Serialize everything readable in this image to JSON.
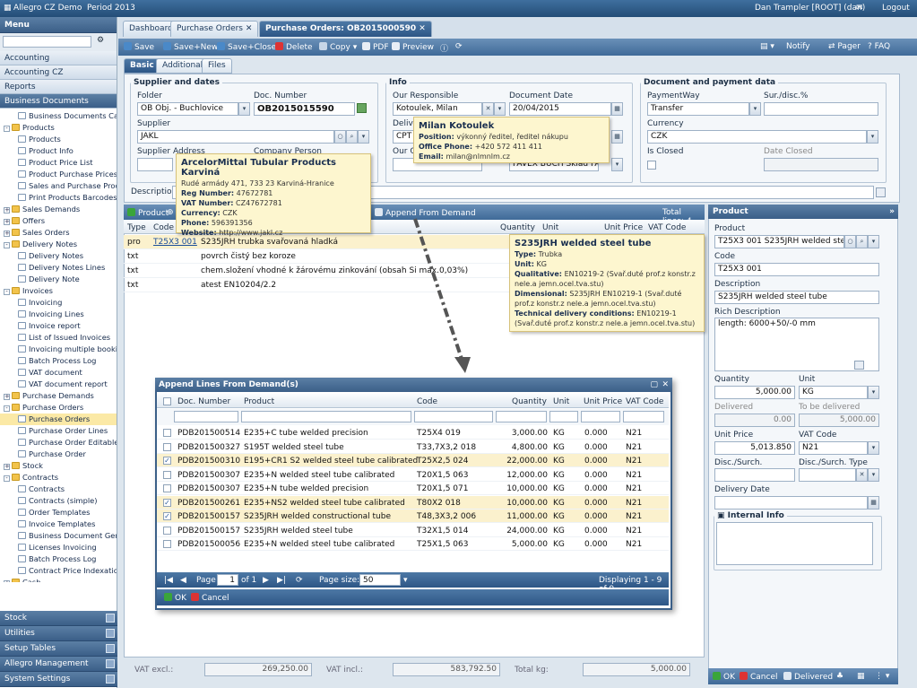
{
  "topbar": {
    "company": "Allegro CZ Demo",
    "period": "Period 2013",
    "user": "Dan Trampler [ROOT] (dan)",
    "logout": "Logout"
  },
  "menu": {
    "title": "Menu",
    "sections": [
      "Accounting",
      "Accounting CZ",
      "Reports",
      "Business Documents"
    ],
    "tree": [
      {
        "label": "Business Documents Calend",
        "type": "doc",
        "indent": 1
      },
      {
        "label": "Products",
        "type": "fold",
        "indent": 0,
        "toggle": "-"
      },
      {
        "label": "Products",
        "type": "doc",
        "indent": 1
      },
      {
        "label": "Product Info",
        "type": "doc",
        "indent": 1
      },
      {
        "label": "Product Price List",
        "type": "doc",
        "indent": 1
      },
      {
        "label": "Product Purchase Prices",
        "type": "doc",
        "indent": 1
      },
      {
        "label": "Sales and Purchase Prod",
        "type": "doc",
        "indent": 1
      },
      {
        "label": "Print Products Barcodes",
        "type": "doc",
        "indent": 1
      },
      {
        "label": "Sales Demands",
        "type": "fold",
        "indent": 0,
        "toggle": "+"
      },
      {
        "label": "Offers",
        "type": "fold",
        "indent": 0,
        "toggle": "+"
      },
      {
        "label": "Sales Orders",
        "type": "fold",
        "indent": 0,
        "toggle": "+"
      },
      {
        "label": "Delivery Notes",
        "type": "fold",
        "indent": 0,
        "toggle": "-"
      },
      {
        "label": "Delivery Notes",
        "type": "doc",
        "indent": 1
      },
      {
        "label": "Delivery Notes Lines",
        "type": "doc",
        "indent": 1
      },
      {
        "label": "Delivery Note",
        "type": "doc",
        "indent": 1
      },
      {
        "label": "Invoices",
        "type": "fold",
        "indent": 0,
        "toggle": "-"
      },
      {
        "label": "Invoicing",
        "type": "doc",
        "indent": 1
      },
      {
        "label": "Invoicing Lines",
        "type": "doc",
        "indent": 1
      },
      {
        "label": "Invoice report",
        "type": "doc",
        "indent": 1
      },
      {
        "label": "List of Issued Invoices",
        "type": "doc",
        "indent": 1
      },
      {
        "label": "Invoicing multiple booking",
        "type": "doc",
        "indent": 1
      },
      {
        "label": "Batch Process Log",
        "type": "doc",
        "indent": 1
      },
      {
        "label": "VAT document",
        "type": "doc",
        "indent": 1
      },
      {
        "label": "VAT document report",
        "type": "doc",
        "indent": 1
      },
      {
        "label": "Purchase Demands",
        "type": "fold",
        "indent": 0,
        "toggle": "+"
      },
      {
        "label": "Purchase Orders",
        "type": "fold",
        "indent": 0,
        "toggle": "-"
      },
      {
        "label": "Purchase Orders",
        "type": "doc",
        "indent": 1,
        "selected": true
      },
      {
        "label": "Purchase Order Lines",
        "type": "doc",
        "indent": 1
      },
      {
        "label": "Purchase Order Editable L",
        "type": "doc",
        "indent": 1
      },
      {
        "label": "Purchase Order",
        "type": "doc",
        "indent": 1
      },
      {
        "label": "Stock",
        "type": "fold",
        "indent": 0,
        "toggle": "+"
      },
      {
        "label": "Contracts",
        "type": "fold",
        "indent": 0,
        "toggle": "-"
      },
      {
        "label": "Contracts",
        "type": "doc",
        "indent": 1
      },
      {
        "label": "Contracts (simple)",
        "type": "doc",
        "indent": 1
      },
      {
        "label": "Order Templates",
        "type": "doc",
        "indent": 1
      },
      {
        "label": "Invoice Templates",
        "type": "doc",
        "indent": 1
      },
      {
        "label": "Business Document Gene",
        "type": "doc",
        "indent": 1
      },
      {
        "label": "Licenses Invoicing",
        "type": "doc",
        "indent": 1
      },
      {
        "label": "Batch Process Log",
        "type": "doc",
        "indent": 1
      },
      {
        "label": "Contract Price Indexation",
        "type": "doc",
        "indent": 1
      },
      {
        "label": "Cash",
        "type": "fold",
        "indent": 0,
        "toggle": "+"
      }
    ],
    "bottom": [
      "Stock",
      "Utilities",
      "Setup Tables",
      "Allegro Management",
      "System Settings"
    ]
  },
  "tabs": [
    "Dashboard",
    "Purchase Orders",
    "Purchase Orders: OB2015000590"
  ],
  "toolbar": {
    "save": "Save",
    "save_new": "Save+New",
    "save_close": "Save+Close",
    "delete": "Delete",
    "copy": "Copy",
    "pdf": "PDF",
    "preview": "Preview",
    "notify": "Notify",
    "pager": "Pager",
    "faq": "FAQ"
  },
  "subtabs": [
    "Basic",
    "Additional",
    "Files"
  ],
  "supplier": {
    "legend": "Supplier and dates",
    "folder_label": "Folder",
    "folder": "OB Obj. - Buchlovice",
    "docnum_label": "Doc. Number",
    "docnum": "OB2015015590",
    "supplier_label": "Supplier",
    "supplier": "JAKL",
    "address_label": "Supplier Address",
    "company_label": "Company Person"
  },
  "info": {
    "legend": "Info",
    "resp_label": "Our Responsible",
    "resp": "Kotoulek, Milan",
    "date_label": "Document Date",
    "date": "20/04/2015",
    "deliv_label": "Delive",
    "deliv": "CPT",
    "ourc_label": "Our C",
    "stock": "FAVEX BUCH Sklad FAVE"
  },
  "payment": {
    "legend": "Document and payment data",
    "pw_label": "PaymentWay",
    "pw": "Transfer",
    "sur_label": "Sur./disc.%",
    "cur_label": "Currency",
    "cur": "CZK",
    "closed_label": "Is Closed",
    "dclosed_label": "Date Closed"
  },
  "description_label": "Description:",
  "tip_supplier": {
    "title": "ArcelorMittal Tubular Products Karviná",
    "address": "Rudé armády 471, 733 23 Karviná-Hranice",
    "rows": [
      [
        "Reg Number:",
        "47672781"
      ],
      [
        "VAT Number:",
        "CZ47672781"
      ],
      [
        "Currency:",
        "CZK"
      ],
      [
        "Phone:",
        "596391356"
      ],
      [
        "Website:",
        "http://www.jakl.cz"
      ]
    ]
  },
  "tip_person": {
    "title": "Milan Kotoulek",
    "rows": [
      [
        "Position:",
        "výkonný ředitel, ředitel nákupu"
      ],
      [
        "Office Phone:",
        "+420 572 411 411"
      ],
      [
        "Email:",
        "milan@nlmnlm.cz"
      ]
    ]
  },
  "tip_product": {
    "title": "S235JRH welded steel tube",
    "rows": [
      [
        "Type:",
        "Trubka"
      ],
      [
        "Unit:",
        "KG"
      ],
      [
        "Qualitative:",
        "EN10219-2 (Svař.duté prof.z konstr.z nele.a jemn.ocel.tva.stu)"
      ],
      [
        "Dimensional:",
        "S235JRH EN10219-1 (Svař.duté prof.z konstr.z nele.a jemn.ocel.tva.stu)"
      ],
      [
        "Technical delivery conditions:",
        "EN10219-1 (Svař.duté prof.z konstr.z nele.a jemn.ocel.tva.stu)"
      ]
    ]
  },
  "grid": {
    "add_product": "Product",
    "append": "Append From Demand",
    "total": "Total lines: 4",
    "cols": [
      "Type",
      "Code",
      "Quantity",
      "Unit",
      "Unit Price",
      "VAT Code"
    ],
    "rows": [
      {
        "type": "pro",
        "code": "T25X3 001",
        "desc": "S235JRH trubka svařovaná hladká"
      },
      {
        "type": "txt",
        "code": "",
        "desc": "povrch čistý bez koroze"
      },
      {
        "type": "txt",
        "code": "",
        "desc": "chem.složení vhodné k žárovému zinkování (obsah Si max.0,03%)"
      },
      {
        "type": "txt",
        "code": "",
        "desc": "atest EN10204/2.2"
      }
    ]
  },
  "footer": {
    "vat_excl_label": "VAT excl.:",
    "vat_excl": "269,250.00",
    "vat_incl_label": "VAT incl.:",
    "vat_incl": "583,792.50",
    "kg_label": "Total kg:",
    "kg": "5,000.00"
  },
  "product": {
    "title": "Product",
    "product_label": "Product",
    "product": "T25X3 001 S235JRH welded steel t",
    "code_label": "Code",
    "code": "T25X3 001",
    "desc_label": "Description",
    "desc": "S235JRH welded steel tube",
    "rich_label": "Rich Description",
    "rich": "length: 6000+50/-0 mm",
    "qty_label": "Quantity",
    "qty": "5,000.00",
    "unit_label": "Unit",
    "unit": "KG",
    "delivered_label": "Delivered",
    "delivered": "0.00",
    "tobe_label": "To be delivered",
    "tobe": "5,000.00",
    "price_label": "Unit Price",
    "price": "5,013.850",
    "vat_label": "VAT Code",
    "vat": "N21",
    "disc_label": "Disc./Surch.",
    "disctype_label": "Disc./Surch. Type",
    "deldate_label": "Delivery Date",
    "internal_label": "Internal Info",
    "ok": "OK",
    "cancel": "Cancel",
    "delivered_btn": "Delivered"
  },
  "dialog": {
    "title": "Append Lines From Demand(s)",
    "cols": [
      "Doc. Number",
      "Product",
      "Code",
      "Quantity",
      "Unit",
      "Unit Price",
      "VAT Code"
    ],
    "rows": [
      {
        "doc": "PDB201500514",
        "product": "E235+C tube welded precision",
        "code": "T25X4 019",
        "qty": "3,000.00",
        "unit": "KG",
        "price": "0.000",
        "vat": "N21",
        "checked": false
      },
      {
        "doc": "PDB201500327",
        "product": "S195T welded steel tube",
        "code": "T33,7X3,2 018",
        "qty": "4,800.00",
        "unit": "KG",
        "price": "0.000",
        "vat": "N21",
        "checked": false
      },
      {
        "doc": "PDB201500310",
        "product": "E195+CR1 S2 welded steel tube calibrated",
        "code": "T25X2,5 024",
        "qty": "22,000.00",
        "unit": "KG",
        "price": "0.000",
        "vat": "N21",
        "checked": true
      },
      {
        "doc": "PDB201500307",
        "product": "E235+N welded steel tube calibrated",
        "code": "T20X1,5 063",
        "qty": "12,000.00",
        "unit": "KG",
        "price": "0.000",
        "vat": "N21",
        "checked": false
      },
      {
        "doc": "PDB201500307",
        "product": "E235+N tube welded precision",
        "code": "T20X1,5 071",
        "qty": "10,000.00",
        "unit": "KG",
        "price": "0.000",
        "vat": "N21",
        "checked": false
      },
      {
        "doc": "PDB201500261",
        "product": "E235+NS2 welded steel tube calibrated",
        "code": "T80X2 018",
        "qty": "10,000.00",
        "unit": "KG",
        "price": "0.000",
        "vat": "N21",
        "checked": true
      },
      {
        "doc": "PDB201500157",
        "product": "S235JRH welded constructional tube",
        "code": "T48,3X3,2 006",
        "qty": "11,000.00",
        "unit": "KG",
        "price": "0.000",
        "vat": "N21",
        "checked": true
      },
      {
        "doc": "PDB201500157",
        "product": "S235JRH welded steel tube",
        "code": "T32X1,5 014",
        "qty": "24,000.00",
        "unit": "KG",
        "price": "0.000",
        "vat": "N21",
        "checked": false
      },
      {
        "doc": "PDB201500056",
        "product": "E235+N welded steel tube calibrated",
        "code": "T25X1,5 063",
        "qty": "5,000.00",
        "unit": "KG",
        "price": "0.000",
        "vat": "N21",
        "checked": false
      }
    ],
    "page_label": "Page",
    "page": "1",
    "of": "of 1",
    "pagesize_label": "Page size:",
    "pagesize": "50",
    "display": "Displaying 1 - 9 of 9",
    "ok": "OK",
    "cancel": "Cancel"
  }
}
